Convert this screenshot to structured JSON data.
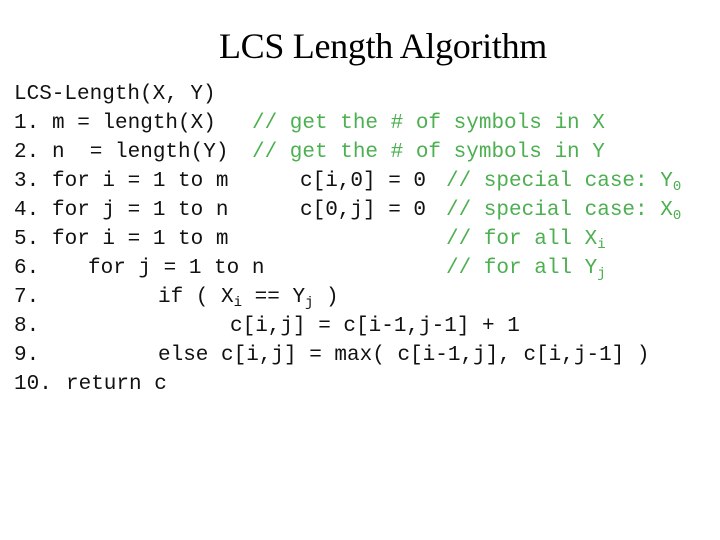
{
  "slide": {
    "title": "LCS Length Algorithm",
    "comment_color": "#4caf50",
    "code": {
      "header": "LCS-Length(X, Y)",
      "lines": [
        {
          "num": "1.",
          "code": "m = length(X)",
          "comment": "// get the # of symbols in X"
        },
        {
          "num": "2.",
          "code": "n  = length(Y)",
          "comment": "// get the # of symbols in Y"
        },
        {
          "num": "3.",
          "code": "for i = 1 to m",
          "code2": "c[i,0] = 0",
          "comment": "// special case: Y",
          "comment_sub": "0"
        },
        {
          "num": "4.",
          "code": "for j = 1 to n",
          "code2": "c[0,j] = 0",
          "comment": "// special case: X",
          "comment_sub": "0"
        },
        {
          "num": "5.",
          "code": "for i = 1 to m",
          "comment": "// for all X",
          "comment_sub": "i"
        },
        {
          "num": "6.",
          "code": "for j = 1 to n",
          "comment": "// for all Y",
          "comment_sub": "j"
        },
        {
          "num": "7.",
          "code_a": "if ( X",
          "sub_a": "i",
          "code_b": " == Y",
          "sub_b": "j",
          "code_c": " )"
        },
        {
          "num": "8.",
          "code": "c[i,j] = c[i-1,j-1] + 1"
        },
        {
          "num": "9.",
          "code": "else c[i,j] = max( c[i-1,j], c[i,j-1] )"
        },
        {
          "num": "10.",
          "code": "return c"
        }
      ]
    }
  }
}
